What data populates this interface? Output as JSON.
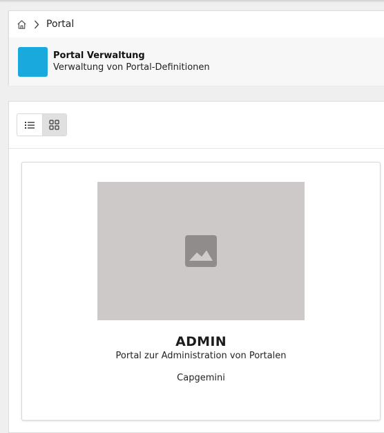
{
  "breadcrumb": {
    "home_icon": "home-icon",
    "separator_icon": "chevron-right-icon",
    "current": "Portal"
  },
  "header": {
    "tile_color": "#19a9dd",
    "title": "Portal Verwaltung",
    "subtitle": "Verwaltung von Portal-Definitionen"
  },
  "toolbar": {
    "views": [
      {
        "icon": "list-view-icon",
        "active": false
      },
      {
        "icon": "grid-view-icon",
        "active": true
      }
    ]
  },
  "portals": [
    {
      "image_icon": "image-placeholder-icon",
      "name": "ADMIN",
      "description": "Portal zur Administration von Portalen",
      "owner": "Capgemini"
    }
  ]
}
